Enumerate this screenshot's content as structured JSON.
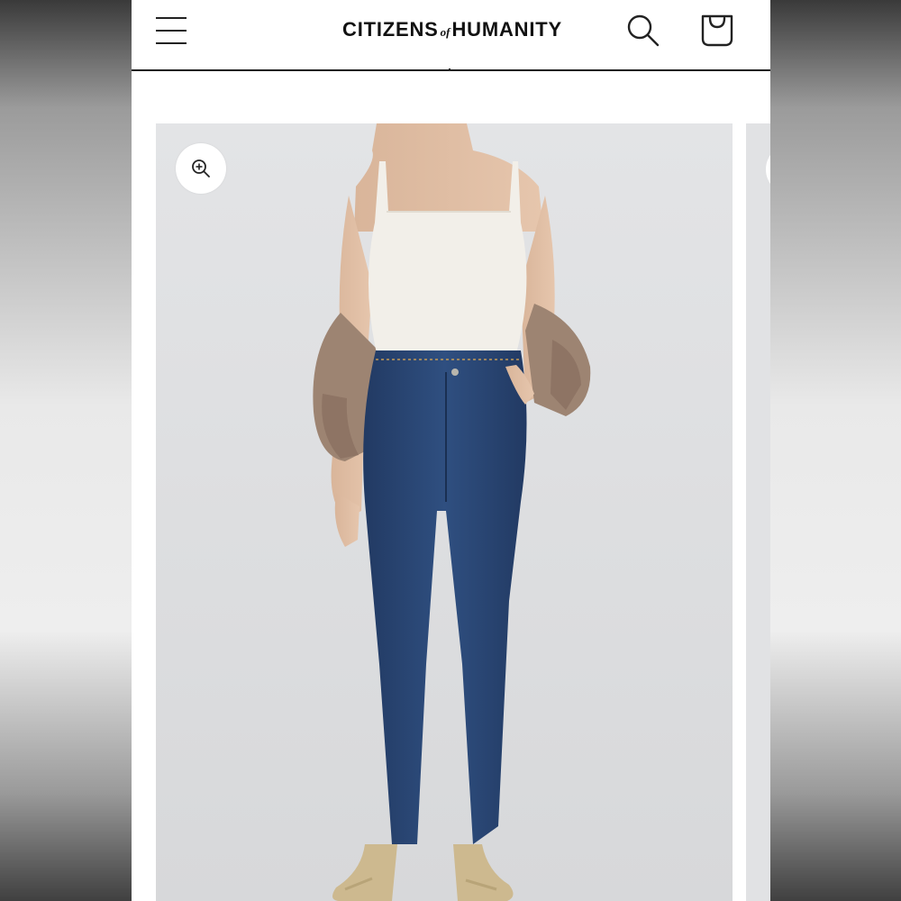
{
  "header": {
    "logo_left": "CITIZENS",
    "logo_of": "of",
    "logo_right": "HUMANITY"
  },
  "icons": {
    "menu": "hamburger-menu-icon",
    "search": "search-icon",
    "cart": "shopping-bag-icon",
    "zoom": "zoom-in-icon"
  },
  "colors": {
    "background": "#ffffff",
    "text": "#111111",
    "gallery_bg": "#dedfe1",
    "denim": "#2b4673"
  }
}
